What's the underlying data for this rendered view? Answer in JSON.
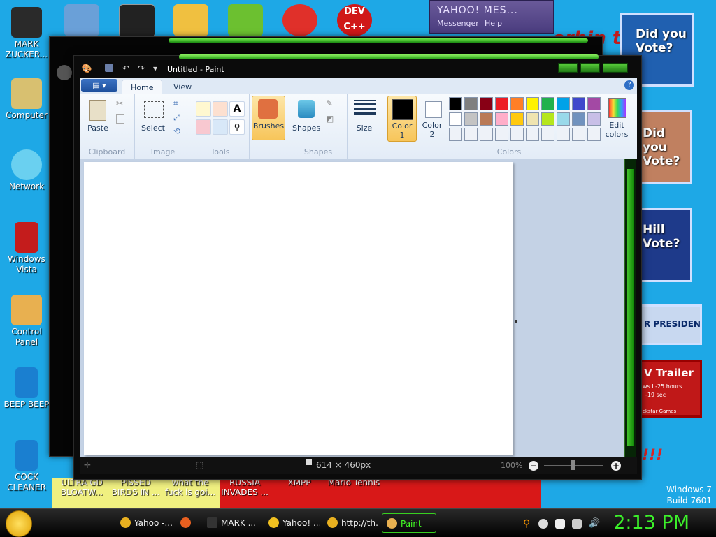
{
  "desktop_icons": [
    {
      "label": "MARK ZUCKER...",
      "color": "#2a2a2a"
    },
    {
      "label": "Computer",
      "color": "#d8c070"
    },
    {
      "label": "Network",
      "color": "#6ad0f0"
    },
    {
      "label": "Windows Vista",
      "color": "#c41c1c"
    },
    {
      "label": "Control Panel",
      "color": "#e8b050"
    },
    {
      "label": "BEEP BEEP",
      "color": "#1a7fd0"
    },
    {
      "label": "COCK CLEANER",
      "color": "#1a7fd0"
    }
  ],
  "bottom_icon_labels": [
    {
      "label": "ULTRA GD BLOATW..."
    },
    {
      "label": "PISSED BIRDS IN ..."
    },
    {
      "label": "what the fuck is goi..."
    },
    {
      "label": "RUSSIA INVADES ..."
    },
    {
      "label": "XMPP"
    },
    {
      "label": "Mario Tennis"
    }
  ],
  "top_icons": [
    {
      "name": "cmd",
      "color": "#222"
    },
    {
      "name": "msn",
      "color": "#f0c040"
    },
    {
      "name": "birds",
      "color": "#6cc030"
    },
    {
      "name": "p-app",
      "color": "#e0302a"
    },
    {
      "name": "dev-cpp",
      "color": "#d01818",
      "label": "DEV C++"
    }
  ],
  "yahoo": {
    "title": "YAHOO! MES...",
    "item1": "Messenger",
    "item2": "Help"
  },
  "ads": [
    {
      "text": "Did you Vote?"
    },
    {
      "text": "Did you Vote?"
    },
    {
      "text": "Hill Vote?"
    },
    {
      "text": "R PRESIDENT"
    },
    {
      "text": "V Trailer",
      "sub1": "ws I -25 hours",
      "sub2": "-19 sec",
      "sub3": "ckstar Games"
    }
  ],
  "ad_red_banner": "orbin t",
  "exclaim": "!!!",
  "paint": {
    "title": "Untitled - Paint",
    "tabs": [
      "Home",
      "View"
    ],
    "groups": {
      "clipboard": {
        "label": "Clipboard",
        "paste": "Paste"
      },
      "image": {
        "label": "Image",
        "select": "Select"
      },
      "tools": {
        "label": "Tools"
      },
      "brushes": {
        "label": "Brushes"
      },
      "shapes": {
        "label": "Shapes",
        "shapes_btn": "Shapes"
      },
      "size": {
        "label": "Size"
      },
      "colors": {
        "label": "Colors",
        "color1": "Color 1",
        "color2": "Color 2",
        "edit": "Edit colors"
      }
    },
    "palette_row1": [
      "#000000",
      "#7f7f7f",
      "#880015",
      "#ed1c24",
      "#ff7f27",
      "#fff200",
      "#22b14c",
      "#00a2e8",
      "#3f48cc",
      "#a349a4"
    ],
    "palette_row2": [
      "#ffffff",
      "#c3c3c3",
      "#b97a57",
      "#ffaec9",
      "#ffc90e",
      "#efe4b0",
      "#b5e61d",
      "#99d9ea",
      "#7092be",
      "#c8bfe7"
    ],
    "canvas_size": "614 × 460px",
    "zoom": "100%"
  },
  "taskbar": {
    "tasks": [
      {
        "label": "Yahoo -...",
        "color": "#e8b020"
      },
      {
        "label": "",
        "color": "#e86020"
      },
      {
        "label": "MARK ...",
        "color": "#333"
      },
      {
        "label": "Yahoo! ...",
        "color": "#f0c020"
      },
      {
        "label": "http://th...",
        "color": "#e8b020"
      },
      {
        "label": "Paint",
        "color": "#e8b050"
      }
    ],
    "clock": "2:13 PM"
  },
  "watermark": {
    "line1": "Windows 7",
    "line2": "Build 7601"
  }
}
